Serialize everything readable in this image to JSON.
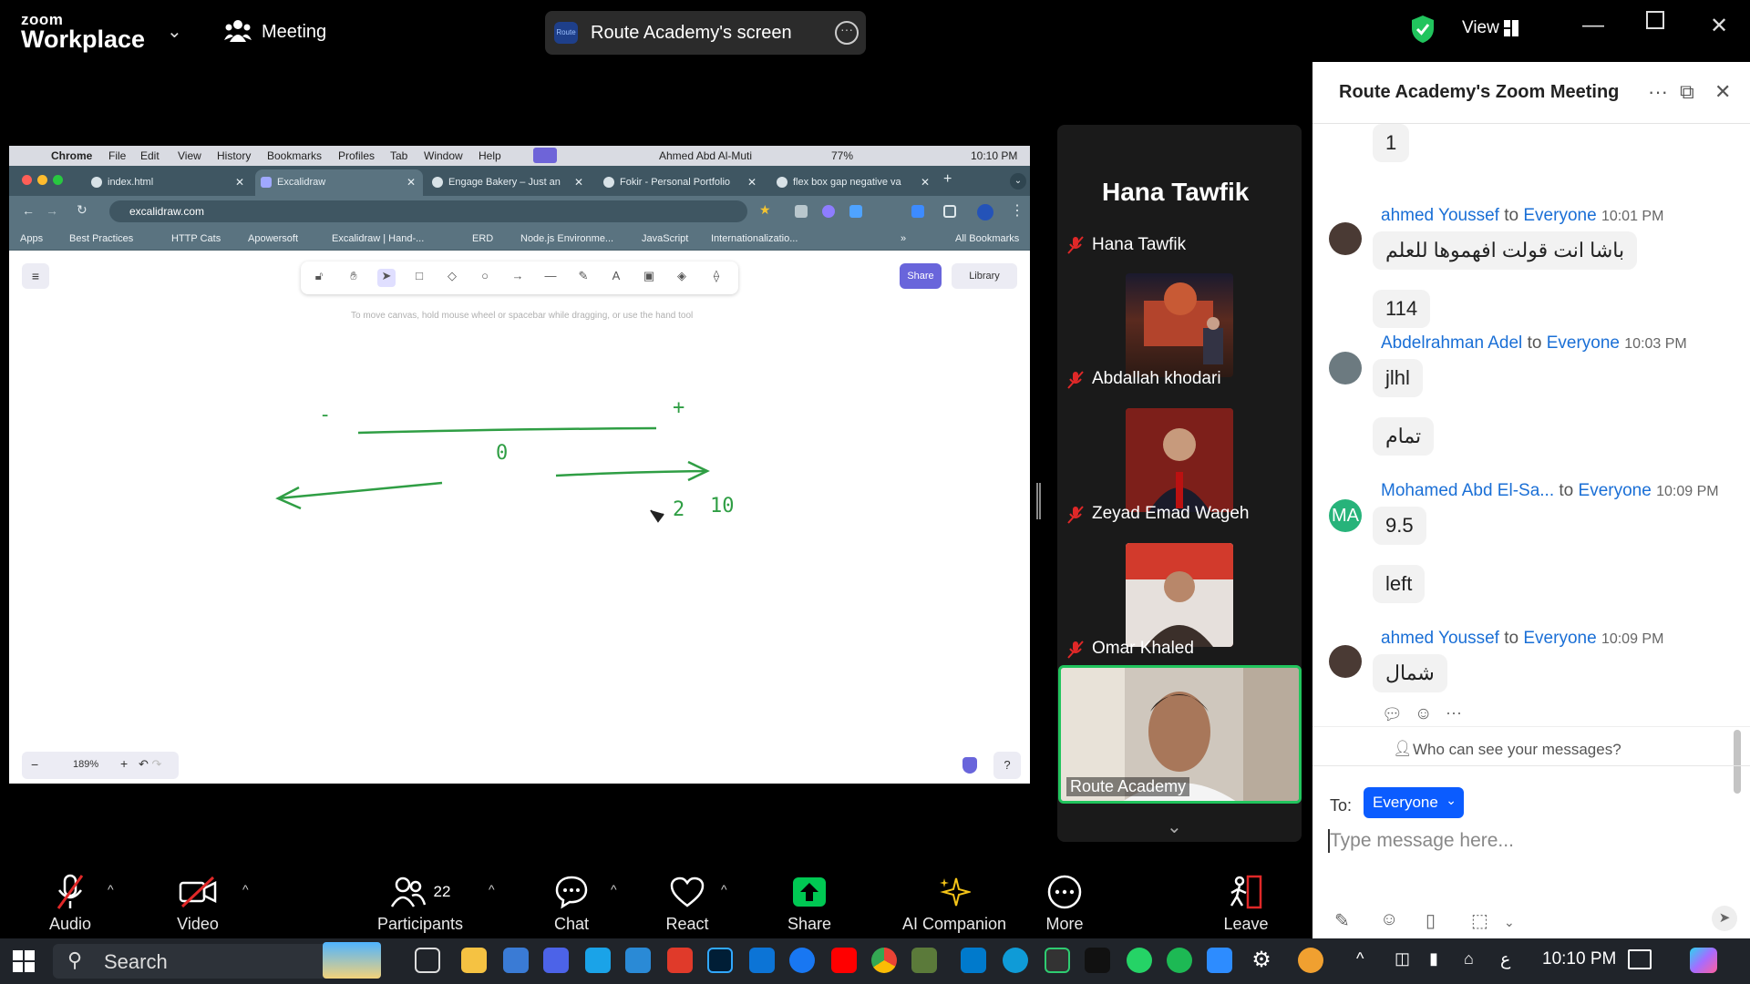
{
  "zoom": {
    "brand_small": "zoom",
    "brand": "Workplace",
    "meeting_label": "Meeting",
    "screen_title": "Route Academy's screen",
    "screen_logo_text": "Route",
    "view_label": "View"
  },
  "shared_screen": {
    "mac_menu": [
      "Chrome",
      "File",
      "Edit",
      "View",
      "History",
      "Bookmarks",
      "Profiles",
      "Tab",
      "Window",
      "Help"
    ],
    "mac_user": "Ahmed Abd Al-Muti",
    "mac_battery": "77%",
    "mac_clock": "10:10 PM",
    "tabs": [
      "index.html",
      "Excalidraw",
      "Engage Bakery – Just an",
      "Fokir - Personal Portfolio",
      "flex box gap negative va"
    ],
    "url": "excalidraw.com",
    "bookmarks": [
      "Apps",
      "Best Practices",
      "HTTP Cats",
      "Apowersoft",
      "Excalidraw | Hand-...",
      "ERD",
      "Node.js Environme...",
      "JavaScript",
      "Internationalizatio...",
      "All Bookmarks"
    ],
    "excalidraw": {
      "hint": "To move canvas, hold mouse wheel or spacebar while dragging, or use the hand tool",
      "share_label": "Share",
      "library_label": "Library",
      "zoom_level": "189%",
      "drawing_texts": [
        "-",
        "+",
        "0",
        "2",
        "10"
      ]
    }
  },
  "gallery": {
    "active_speaker": "Hana Tawfik",
    "participants": [
      "Hana Tawfik",
      "Abdallah khodari",
      "Zeyad Emad Wageh",
      "Omar Khaled",
      "Route Academy"
    ]
  },
  "chat": {
    "title": "Route Academy's Zoom Meeting",
    "to_word": "to",
    "everyone": "Everyone",
    "messages": [
      {
        "text": "1"
      },
      {
        "sender": "ahmed Youssef",
        "time": "10:01 PM",
        "text": "باشا انت قولت افهموها للعلم"
      },
      {
        "text": "114"
      },
      {
        "sender": "Abdelrahman Adel",
        "time": "10:03 PM",
        "text": "jlhl"
      },
      {
        "text": "تمام"
      },
      {
        "sender": "Mohamed Abd El-Sa...",
        "time": "10:09 PM",
        "text": "9.5",
        "initials": "MA"
      },
      {
        "text": "left"
      },
      {
        "sender": "ahmed Youssef",
        "time": "10:09 PM",
        "text": "شمال"
      }
    ],
    "who_can_see": "Who can see your messages?",
    "to_label": "To:",
    "recipient": "Everyone",
    "placeholder": "Type message here..."
  },
  "controls": {
    "audio": "Audio",
    "video": "Video",
    "participants": "Participants",
    "participant_count": "22",
    "chat": "Chat",
    "react": "React",
    "share": "Share",
    "ai_companion": "AI Companion",
    "more": "More",
    "leave": "Leave"
  },
  "taskbar": {
    "search": "Search",
    "lang": "ع",
    "time": "10:10 PM"
  },
  "colors": {
    "zoom_blue": "#0b5cff",
    "share_green": "#00c853",
    "active_border": "#21c45d",
    "leave_red": "#e02828",
    "chat_name": "#1a6fd6"
  }
}
